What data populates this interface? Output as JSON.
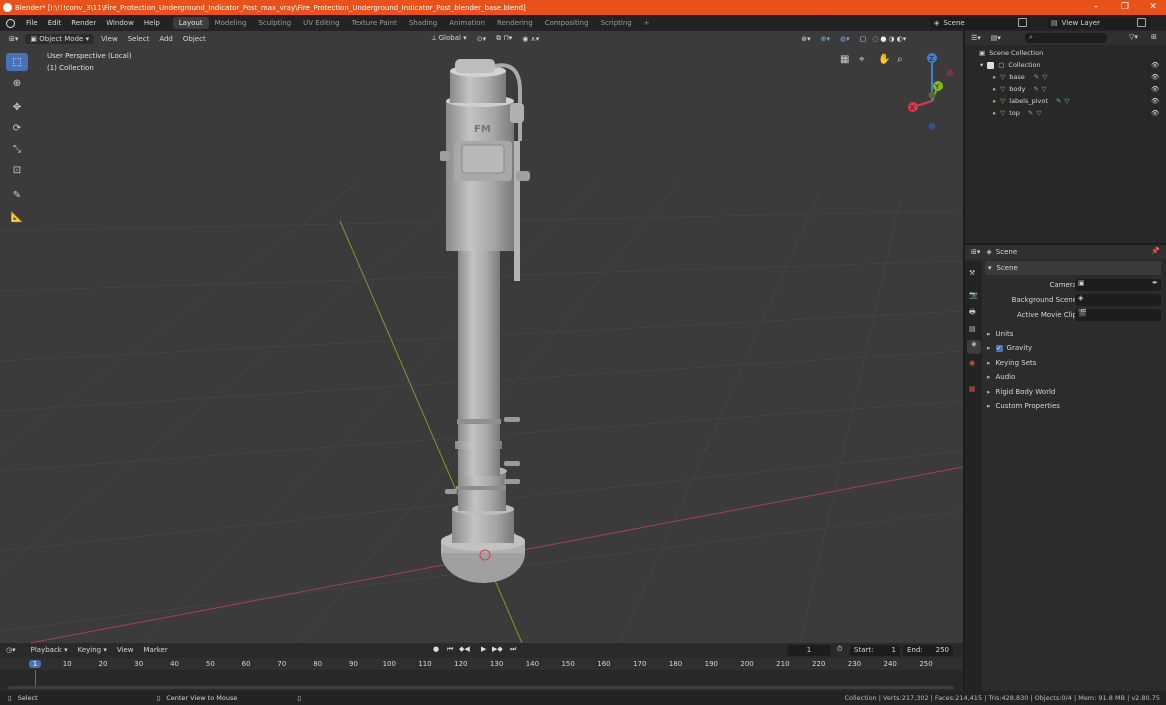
{
  "window": {
    "title": "Blender* [I:\\!!!conv_3\\11\\Fire_Protection_Underground_Indicator_Post_max_vray\\Fire_Protection_Underground_Indicator_Post_blender_base.blend]",
    "min_label": "–",
    "max_label": "❐",
    "close_label": "✕"
  },
  "menu": {
    "items": [
      "File",
      "Edit",
      "Render",
      "Window",
      "Help"
    ],
    "workspaces": [
      "Layout",
      "Modeling",
      "Sculpting",
      "UV Editing",
      "Texture Paint",
      "Shading",
      "Animation",
      "Rendering",
      "Compositing",
      "Scripting"
    ],
    "add_tab": "+",
    "scene_label": "Scene",
    "view_layer_label": "View Layer"
  },
  "viewport": {
    "mode": "Object Mode",
    "menus": [
      "View",
      "Select",
      "Add",
      "Object"
    ],
    "transform_orientation": "Global",
    "overlay_line1": "User Perspective (Local)",
    "overlay_line2": "(1) Collection",
    "model_label": "FM",
    "axis_labels": {
      "x": "X",
      "y": "Y",
      "z": "Z"
    }
  },
  "outliner": {
    "search_placeholder": "",
    "root": "Scene Collection",
    "collection": "Collection",
    "objects": [
      "base",
      "body",
      "labels_pivot",
      "top"
    ]
  },
  "properties": {
    "header_title": "Scene",
    "panel_title": "Scene",
    "fields": [
      {
        "label": "Camera",
        "value": ""
      },
      {
        "label": "Background Scene",
        "value": ""
      },
      {
        "label": "Active Movie Clip",
        "value": ""
      }
    ],
    "sections": [
      {
        "label": "Units",
        "checkbox": false
      },
      {
        "label": "Gravity",
        "checkbox": true
      },
      {
        "label": "Keying Sets",
        "checkbox": false
      },
      {
        "label": "Audio",
        "checkbox": false
      },
      {
        "label": "Rigid Body World",
        "checkbox": false
      },
      {
        "label": "Custom Properties",
        "checkbox": false
      }
    ]
  },
  "timeline": {
    "menus": [
      "Playback",
      "Keying",
      "View",
      "Marker"
    ],
    "current_frame": "1",
    "start_label": "Start:",
    "start_value": "1",
    "end_label": "End:",
    "end_value": "250",
    "ticks": [
      "1",
      "10",
      "20",
      "30",
      "40",
      "50",
      "60",
      "70",
      "80",
      "90",
      "100",
      "110",
      "120",
      "130",
      "140",
      "150",
      "160",
      "170",
      "180",
      "190",
      "200",
      "210",
      "220",
      "230",
      "240",
      "250"
    ]
  },
  "status": {
    "select": "Select",
    "center_view": "Center View to Mouse",
    "stats": "Collection | Verts:217,302 | Faces:214,415 | Tris:428,830 | Objects:0/4 | Mem: 91.8 MB | v2.80.75"
  },
  "colors": {
    "title_bar": "#e8521a",
    "accent": "#4772b3",
    "x_axis": "#d53b50",
    "y_axis": "#85b81a",
    "z_axis": "#3f7ed6"
  }
}
